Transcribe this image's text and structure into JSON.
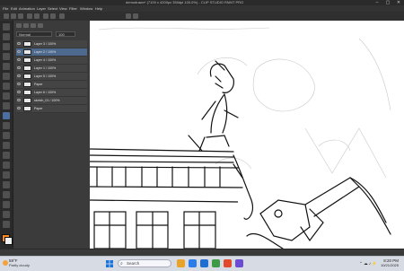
{
  "app": {
    "title": "demodrawn* (7100 x 4200px 350dpi 100.0%) - CLIP STUDIO PAINT PRO",
    "window_controls": [
      "–",
      "▢",
      "✕"
    ]
  },
  "menu": {
    "items": [
      "File",
      "Edit",
      "Animation",
      "Layer",
      "Select",
      "View",
      "Filter",
      "Window",
      "Help"
    ]
  },
  "layer_panel": {
    "blend_mode": "Normal",
    "opacity": "100",
    "layers": [
      {
        "name": "Layer 3 / 100%"
      },
      {
        "name": "Layer 2 / 100%"
      },
      {
        "name": "Layer 4 / 100%"
      },
      {
        "name": "Layer 1 / 100%"
      },
      {
        "name": "Layer 5 / 100%"
      },
      {
        "name": "Paper"
      },
      {
        "name": "Layer 6 / 100%"
      },
      {
        "name": "sketch_01 / 100%"
      },
      {
        "name": "Paper"
      }
    ],
    "selected_index": 1
  },
  "toolbox": {
    "fg_color": "#ff8a1e",
    "bg_color": "#f2f2f2"
  },
  "taskbar": {
    "weather_temp": "59°F",
    "weather_cond": "Partly cloudy",
    "search_placeholder": "Search",
    "time": "8:20 PM",
    "date": "10/21/2025"
  }
}
